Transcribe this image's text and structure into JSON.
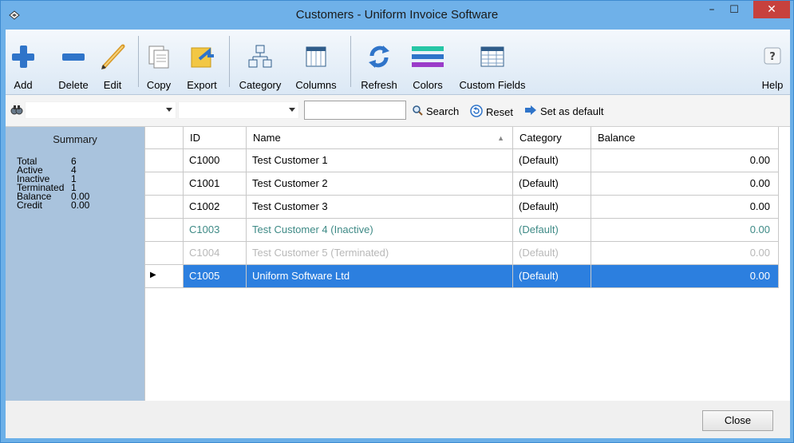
{
  "window": {
    "title": "Customers - Uniform Invoice Software",
    "close_glyph": "✕",
    "min_glyph": "–",
    "max_glyph": "☐"
  },
  "toolbar": {
    "buttons": [
      {
        "label": "Add",
        "icon": "add-icon"
      },
      {
        "label": "Delete",
        "icon": "delete-icon"
      },
      {
        "label": "Edit",
        "icon": "edit-icon"
      },
      {
        "label": "Copy",
        "icon": "copy-icon"
      },
      {
        "label": "Export",
        "icon": "export-icon"
      },
      {
        "label": "Category",
        "icon": "category-icon"
      },
      {
        "label": "Columns",
        "icon": "columns-icon"
      },
      {
        "label": "Refresh",
        "icon": "refresh-icon"
      },
      {
        "label": "Colors",
        "icon": "colors-icon"
      },
      {
        "label": "Custom Fields",
        "icon": "custom-fields-icon"
      },
      {
        "label": "Help",
        "icon": "help-icon"
      }
    ]
  },
  "filter": {
    "field_select": "",
    "operator_select": "",
    "search_value": "",
    "search_label": "Search",
    "reset_label": "Reset",
    "set_default_label": "Set as default"
  },
  "summary": {
    "title": "Summary",
    "rows": [
      {
        "label": "Total",
        "value": "6"
      },
      {
        "label": "Active",
        "value": "4"
      },
      {
        "label": "Inactive",
        "value": "1"
      },
      {
        "label": "Terminated",
        "value": "1"
      },
      {
        "label": "Balance",
        "value": "0.00"
      },
      {
        "label": "Credit",
        "value": "0.00"
      }
    ]
  },
  "grid": {
    "columns": [
      "ID",
      "Name",
      "Category",
      "Balance"
    ],
    "sort_glyph": "▲",
    "rows": [
      {
        "id": "C1000",
        "name": "Test Customer 1",
        "category": "(Default)",
        "balance": "0.00",
        "status": "active"
      },
      {
        "id": "C1001",
        "name": "Test Customer 2",
        "category": "(Default)",
        "balance": "0.00",
        "status": "active"
      },
      {
        "id": "C1002",
        "name": "Test Customer 3",
        "category": "(Default)",
        "balance": "0.00",
        "status": "active"
      },
      {
        "id": "C1003",
        "name": "Test Customer 4 (Inactive)",
        "category": "(Default)",
        "balance": "0.00",
        "status": "inactive"
      },
      {
        "id": "C1004",
        "name": "Test Customer 5 (Terminated)",
        "category": "(Default)",
        "balance": "0.00",
        "status": "terminated"
      },
      {
        "id": "C1005",
        "name": "Uniform Software Ltd",
        "category": "(Default)",
        "balance": "0.00",
        "status": "selected"
      }
    ],
    "row_indicator": "▶"
  },
  "footer": {
    "close_label": "Close"
  },
  "colors": {
    "titlebar": "#6fb1e9",
    "selection": "#2c7fdf",
    "inactive_text": "#3e8a86",
    "terminated_text": "#b8b8b8",
    "close_button": "#c7413d"
  }
}
